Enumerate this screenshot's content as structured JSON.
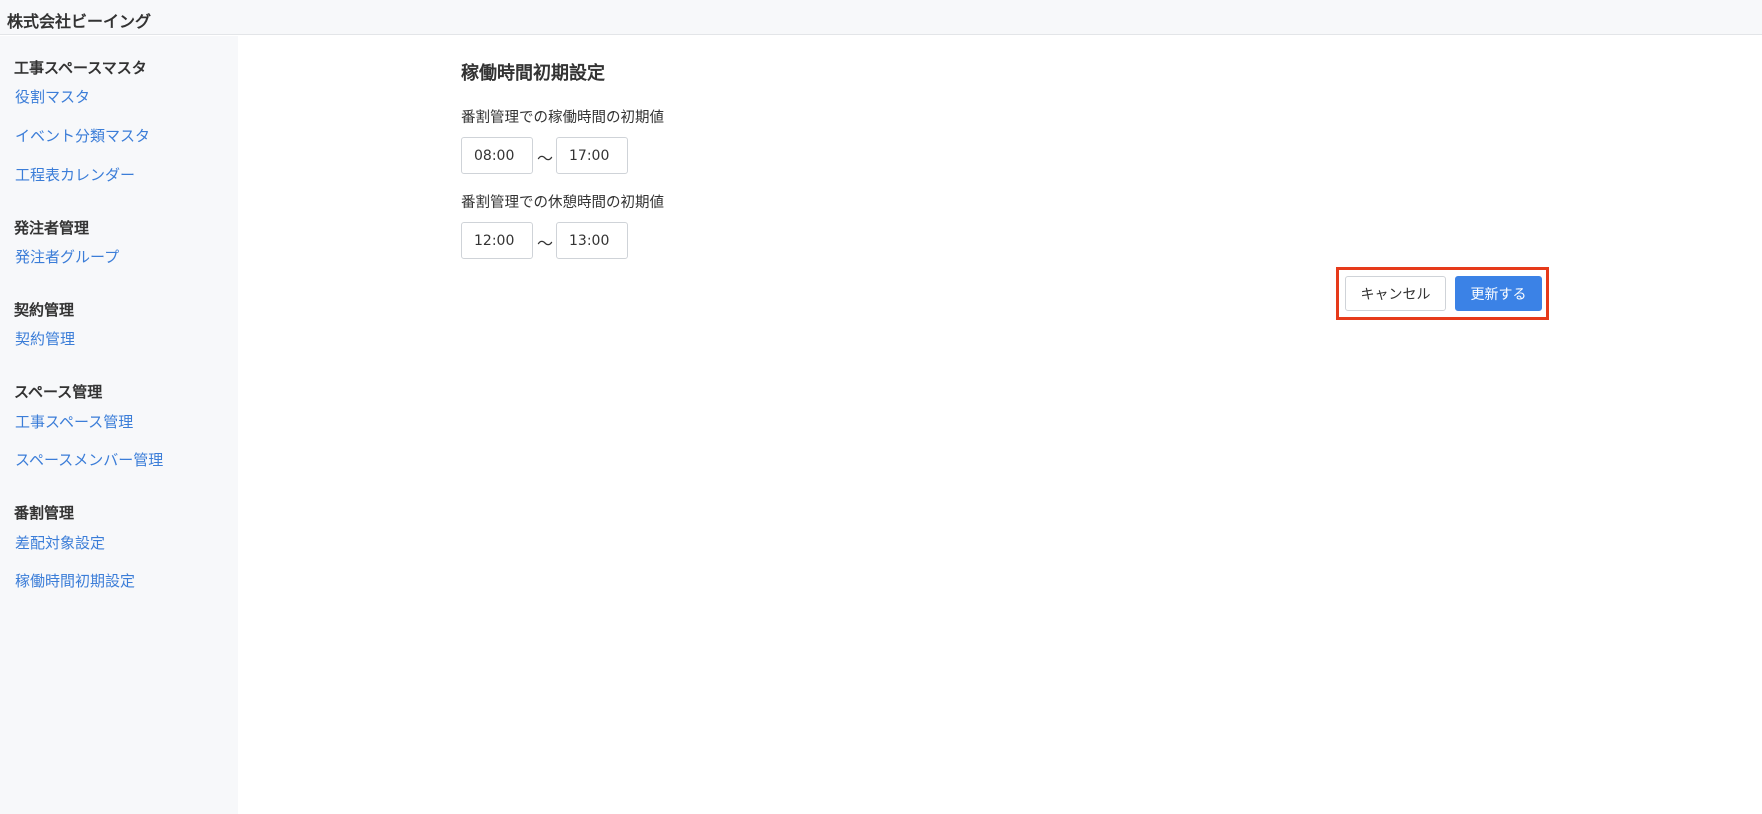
{
  "header": {
    "company_name": "株式会社ビーイング"
  },
  "sidebar": {
    "sections": [
      {
        "heading": "工事スペースマスタ",
        "items": [
          "役割マスタ",
          "イベント分類マスタ",
          "工程表カレンダー"
        ]
      },
      {
        "heading": "発注者管理",
        "items": [
          "発注者グループ"
        ]
      },
      {
        "heading": "契約管理",
        "items": [
          "契約管理"
        ]
      },
      {
        "heading": "スペース管理",
        "items": [
          "工事スペース管理",
          "スペースメンバー管理"
        ]
      },
      {
        "heading": "番割管理",
        "items": [
          "差配対象設定",
          "稼働時間初期設定"
        ]
      }
    ]
  },
  "main": {
    "title": "稼働時間初期設定",
    "working_hours": {
      "label": "番割管理での稼働時間の初期値",
      "start": "08:00",
      "separator": "〜",
      "end": "17:00"
    },
    "break_hours": {
      "label": "番割管理での休憩時間の初期値",
      "start": "12:00",
      "separator": "〜",
      "end": "13:00"
    },
    "buttons": {
      "cancel_label": "キャンセル",
      "update_label": "更新する"
    },
    "colors": {
      "link": "#3b7dd8",
      "primary_button": "#3b82e6",
      "highlight_border": "#e63a1a"
    }
  }
}
